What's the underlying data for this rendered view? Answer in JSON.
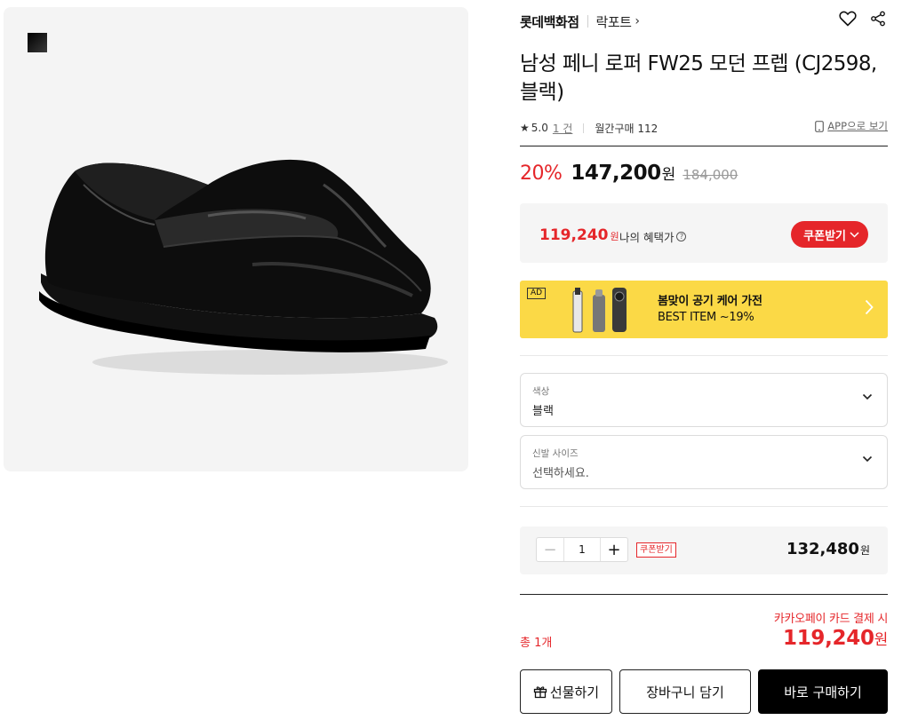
{
  "product": {
    "brand": "롯데백화점",
    "sub_brand": "락포트",
    "sub_brand_chevron": "›",
    "title": "남성 페니 로퍼 FW25 모던 프렙 (CJ2598, 블랙)",
    "rating": "5.0",
    "review_count": "1 건",
    "monthly_purchase": "월간구매 112",
    "app_link": "APP으로 보기",
    "discount": "20%",
    "price": "147,200",
    "price_unit": "원",
    "original_price": "184,000"
  },
  "benefit": {
    "price": "119,240",
    "unit": "원",
    "label": "나의 혜택가",
    "coupon_button": "쿠폰받기"
  },
  "ad": {
    "tag": "AD",
    "line1": "봄맞이 공기 케어 가전",
    "line2": "BEST ITEM ~19%"
  },
  "options": {
    "color": {
      "label": "색상",
      "value": "블랙"
    },
    "size": {
      "label": "신발 사이즈",
      "placeholder": "선택하세요."
    }
  },
  "quantity": {
    "value": "1",
    "coupon": "쿠폰받기",
    "price": "132,480",
    "unit": "원"
  },
  "total": {
    "note": "카카오페이 카드 결제 시",
    "label": "총 1개",
    "price": "119,240",
    "unit": "원"
  },
  "buttons": {
    "gift": "선물하기",
    "cart": "장바구니 담기",
    "buy": "바로 구매하기"
  },
  "icons": {
    "wishlist": "heart-icon",
    "share": "share-icon",
    "phone": "phone-icon",
    "gift": "gift-icon"
  },
  "colors": {
    "accent_red": "#e5262a",
    "ad_yellow": "#fbd946",
    "buy_button": "#000000"
  }
}
